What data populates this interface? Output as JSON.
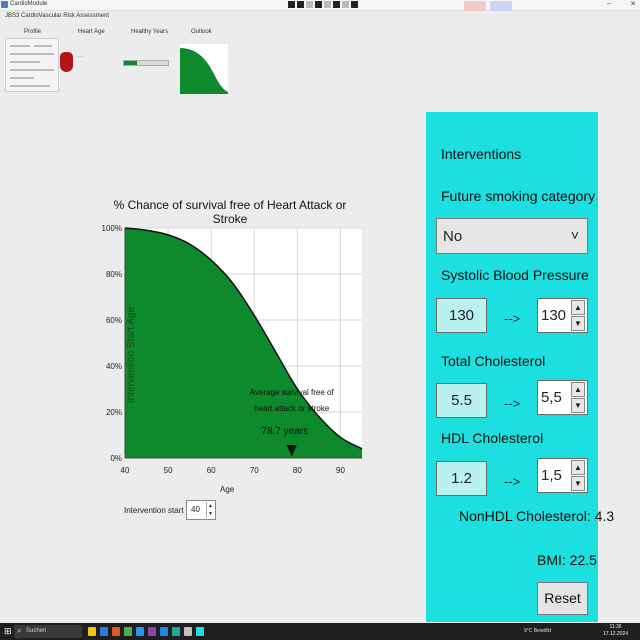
{
  "window": {
    "title": "CardioModule",
    "subtitle": "JBS3 CardioVascular Risk Assessment"
  },
  "top_tabs": [
    "Profile",
    "Heart Age",
    "Healthy Years",
    "Outlook"
  ],
  "main_chart": {
    "title": "% Chance of survival free of Heart Attack or Stroke",
    "xlabel": "Age",
    "vertical_label": "Intervention Start Age",
    "annotation_line1": "Average survival free of",
    "annotation_line2": "heart attack or stroke",
    "annotation_value": "78.7 years",
    "y_ticks": [
      "100%",
      "80%",
      "60%",
      "40%",
      "20%",
      "0%"
    ],
    "x_ticks": [
      "40",
      "50",
      "60",
      "70",
      "80",
      "90"
    ],
    "fill_color": "#0e8a2c"
  },
  "chart_data": {
    "type": "area",
    "x": [
      40,
      45,
      50,
      55,
      60,
      65,
      70,
      75,
      80,
      85,
      90,
      95
    ],
    "values": [
      100,
      99,
      97,
      93,
      86,
      76,
      62,
      46,
      30,
      18,
      9,
      4
    ],
    "xlabel": "Age",
    "ylabel": "",
    "xlim": [
      40,
      95
    ],
    "ylim": [
      0,
      100
    ],
    "annotation_marker_x": 78.7,
    "grid": true
  },
  "intervention_start": {
    "label": "Intervention start age",
    "value": "40"
  },
  "panel": {
    "title": "Interventions",
    "smoking_label": "Future smoking category",
    "smoking_value": "No",
    "sbp_label": "Systolic Blood Pressure",
    "sbp_current": "130",
    "sbp_new": "130",
    "tc_label": "Total Cholesterol",
    "tc_current": "5.5",
    "tc_new": "5,5",
    "hdl_label": "HDL Cholesterol",
    "hdl_current": "1.2",
    "hdl_new": "1,5",
    "arrow": "-->",
    "nonhdl": "NonHDL Cholesterol: 4.3",
    "bmi": "BMI: 22.5",
    "reset": "Reset"
  },
  "taskbar": {
    "search_placeholder": "Suchen",
    "tray_weather": "9°C Bewölkt",
    "time": "11:36",
    "date": "17.12.2024"
  },
  "colors": {
    "panel_bg": "#1ce0df",
    "chart_fill": "#0e8a2c"
  }
}
